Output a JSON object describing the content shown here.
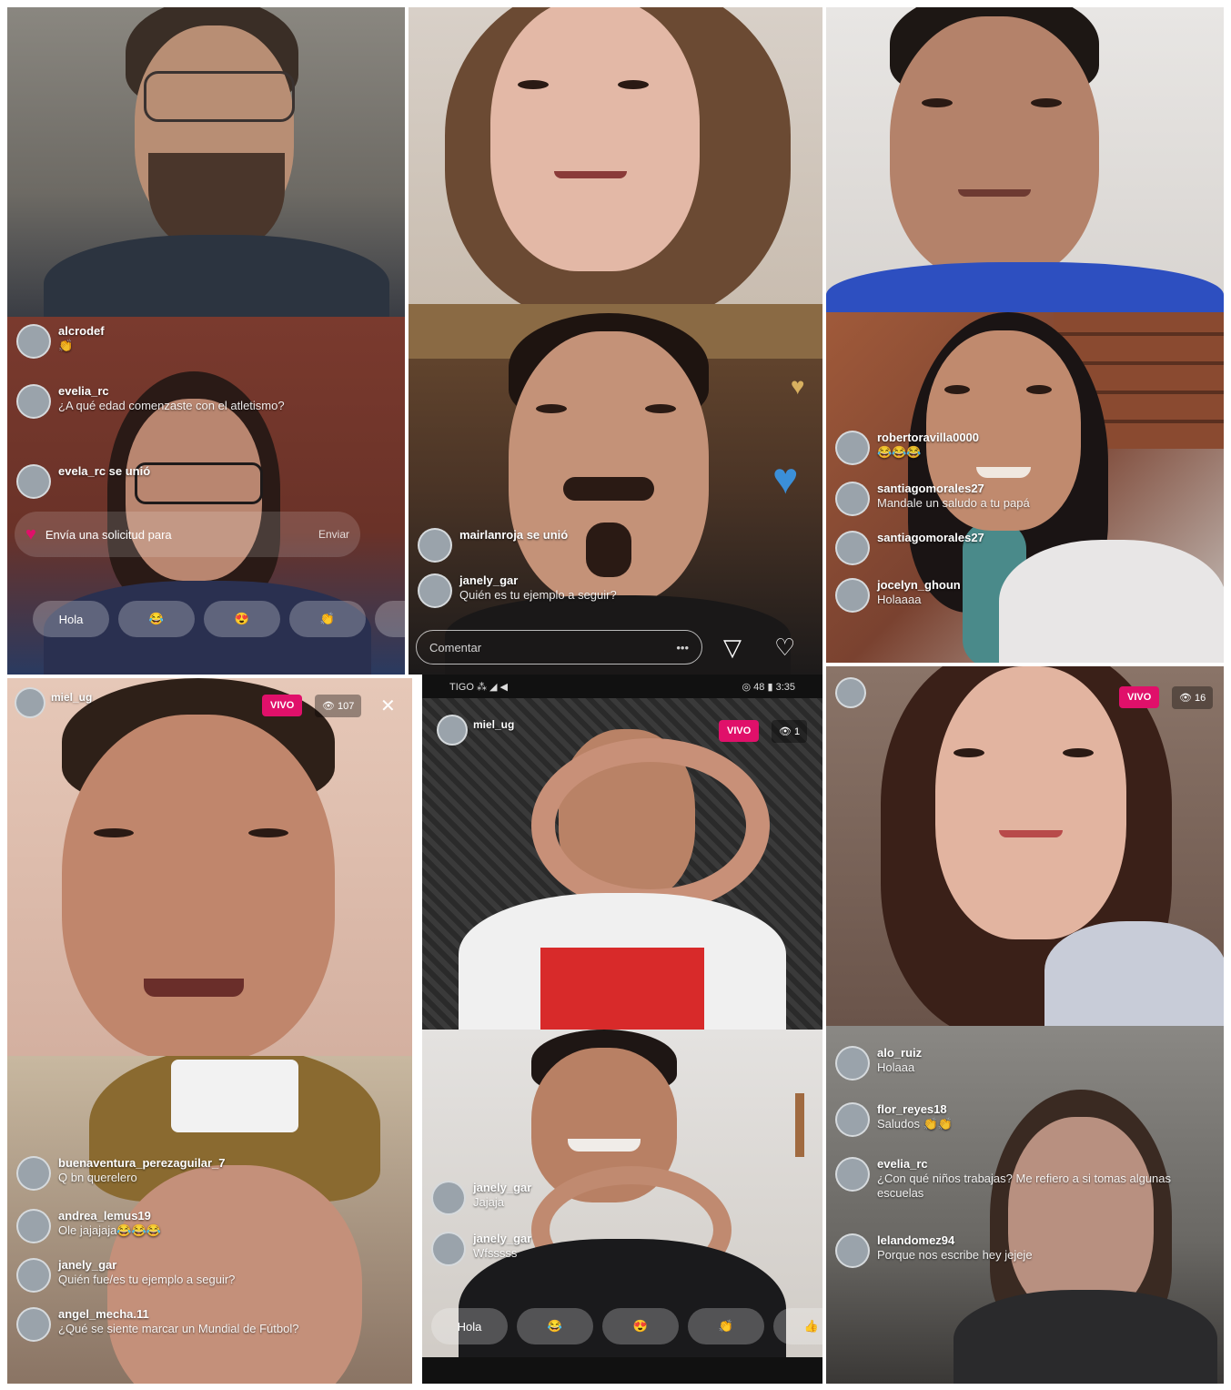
{
  "tile_d": {
    "comments": [
      {
        "user": "alcrodef",
        "msg": "👏"
      },
      {
        "user": "evelia_rc",
        "msg": "¿A qué edad comenzaste con el atletismo?"
      },
      {
        "user": "evela_rc se unió",
        "msg": ""
      }
    ],
    "invite_text": "Envía una solicitud para",
    "invite_action": "Enviar",
    "quick_reactions": [
      "Hola",
      "😂",
      "😍",
      "👏",
      "👍",
      "😂"
    ]
  },
  "tile_e": {
    "comments": [
      {
        "user": "mairlanroja se unió",
        "msg": ""
      },
      {
        "user": "janely_gar",
        "msg": "Quién es tu ejemplo a seguir?"
      }
    ],
    "comment_placeholder": "Comentar",
    "more_icon": "•••",
    "send_icon": "▽",
    "heart_icon": "♡"
  },
  "tile_f": {
    "comments": [
      {
        "user": "robertoravilla0000",
        "msg": "😂😂😂"
      },
      {
        "user": "santiagomorales27",
        "msg": "Mandale un saludo a tu papá"
      },
      {
        "user": "santiagomorales27",
        "msg": ""
      },
      {
        "user": "jocelyn_ghoun",
        "msg": "Holaaaa"
      }
    ]
  },
  "tile_g": {
    "username": "miel_ug",
    "live_badge": "VIVO",
    "viewers": "👁 107",
    "close_icon": "✕"
  },
  "tile_h": {
    "status_left": "TIGO ⁂ ◢ ◀",
    "status_right": "◎ 48 ▮ 3:35",
    "username": "miel_ug",
    "live_badge": "VIVO",
    "viewers": "👁 1"
  },
  "tile_i": {
    "live_badge": "VIVO",
    "viewers": "👁 16"
  },
  "tile_j": {
    "comments": [
      {
        "user": "buenaventura_perezaguilar_7",
        "msg": "Q bn querelero"
      },
      {
        "user": "andrea_lemus19",
        "msg": "Ole jajajaja😂😂😂"
      },
      {
        "user": "janely_gar",
        "msg": "Quién fue/es tu ejemplo a seguir?"
      },
      {
        "user": "angel_mecha.11",
        "msg": "¿Qué se siente marcar un Mundial de Fútbol?"
      }
    ]
  },
  "tile_k": {
    "comments": [
      {
        "user": "janely_gar",
        "msg": "Jajaja"
      },
      {
        "user": "janely_gar",
        "msg": "Wfsssss"
      }
    ],
    "quick_reactions": [
      "Hola",
      "😂",
      "😍",
      "👏",
      "👍",
      "😂"
    ]
  },
  "tile_l": {
    "comments": [
      {
        "user": "alo_ruiz",
        "msg": "Holaaa"
      },
      {
        "user": "flor_reyes18",
        "msg": "Saludos 👏👏"
      },
      {
        "user": "evelia_rc",
        "msg": "¿Con qué niños trabajas? Me refiero a si tomas algunas escuelas"
      },
      {
        "user": "lelandomez94",
        "msg": "Porque nos escribe hey jejeje"
      }
    ]
  },
  "colors": {
    "live": "#e0106a",
    "overlay_text": "#ffffff"
  }
}
